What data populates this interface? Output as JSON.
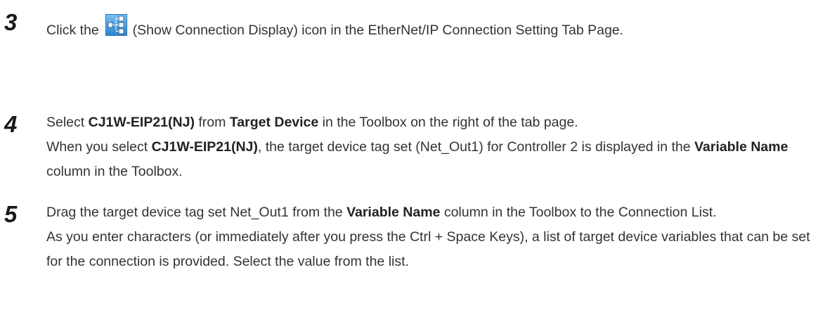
{
  "steps": [
    {
      "number": "3",
      "before_icon": "Click the",
      "icon": "show-connection-display-icon",
      "after_icon": "(Show Connection Display) icon in the EtherNet/IP Connection Setting Tab Page."
    },
    {
      "number": "4",
      "p1_a": "Select ",
      "p1_b": "CJ1W-EIP21(NJ)",
      "p1_c": " from ",
      "p1_d": "Target Device",
      "p1_e": " in the Toolbox on the right of the tab page.",
      "p2_a": "When you select ",
      "p2_b": "CJ1W-EIP21(NJ)",
      "p2_c": ", the target device tag set (Net_Out1) for Controller 2 is displayed in the ",
      "p2_d": "Variable Name",
      "p2_e": " column in the Toolbox."
    },
    {
      "number": "5",
      "p1_a": "Drag the target device tag set Net_Out1 from the ",
      "p1_b": "Variable Name",
      "p1_c": " column in the Toolbox to the Connection List.",
      "p2": "As you enter characters (or immediately after you press the Ctrl + Space Keys), a list of target device variables that can be set for the connection is provided. Select the value from the list."
    }
  ],
  "colors": {
    "icon_bg": "#3f93d9",
    "icon_bg_light": "#6cb3ec",
    "icon_block": "#f4f8fb",
    "text": "#333333",
    "step_number": "#1a1a1a"
  }
}
